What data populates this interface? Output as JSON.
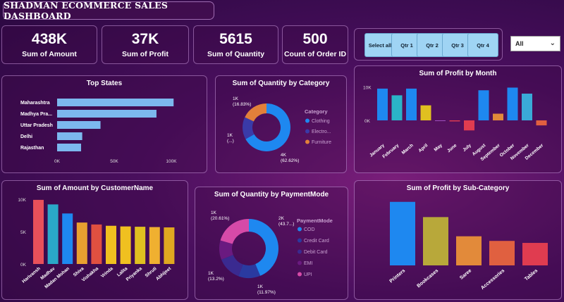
{
  "title": "SHADMAN ECOMMERCE SALES DASHBOARD",
  "kpis": [
    {
      "value": "438K",
      "label": "Sum of Amount"
    },
    {
      "value": "37K",
      "label": "Sum of Profit"
    },
    {
      "value": "5615",
      "label": "Sum of Quantity"
    },
    {
      "value": "500",
      "label": "Count of Order ID"
    }
  ],
  "quarters": [
    "Select all",
    "Qtr 1",
    "Qtr 2",
    "Qtr 3",
    "Qtr 4"
  ],
  "month_filter": {
    "selected": "All"
  },
  "colors": {
    "blue_bar": "#7cb8ee",
    "series": [
      "#1e88f0",
      "#2ab4c8",
      "#3460c8",
      "#e28a3a",
      "#f0c020",
      "#e03c50",
      "#d64aa8",
      "#9a3aa0"
    ]
  },
  "chart_data": [
    {
      "type": "bar",
      "orientation": "horizontal",
      "title": "Top States",
      "categories": [
        "Maharashtra",
        "Madhya Pra...",
        "Uttar Pradesh",
        "Delhi",
        "Rajasthan"
      ],
      "values": [
        102000,
        87000,
        38000,
        22000,
        21000
      ],
      "xticks": [
        "0K",
        "50K",
        "100K"
      ],
      "xlim": [
        0,
        100000
      ]
    },
    {
      "type": "pie",
      "donut": true,
      "title": "Sum of Quantity by Category",
      "legend_title": "Category",
      "categories": [
        "Clothing",
        "Electro...",
        "Furniture"
      ],
      "values": [
        3516,
        795,
        945
      ],
      "data_labels": [
        "4K\n(62.62%)",
        "1K\n(...)",
        "1K\n(16.83%)"
      ],
      "colors": [
        "#1e88f0",
        "#3a3aa8",
        "#e2803a"
      ]
    },
    {
      "type": "bar",
      "title": "Sum of Profit by Month",
      "categories": [
        "January",
        "February",
        "March",
        "April",
        "May",
        "June",
        "July",
        "August",
        "September",
        "October",
        "November",
        "December"
      ],
      "values": [
        9500,
        7500,
        9500,
        4500,
        -200,
        -300,
        -3000,
        9000,
        2000,
        9800,
        8000,
        -1500
      ],
      "yticks": [
        "10K",
        "0K"
      ],
      "ylim": [
        -4000,
        12000
      ],
      "colors": [
        "#1e88f0",
        "#2ab4c8",
        "#1e88f0",
        "#e0c020",
        "#a050c0",
        "#e03c50",
        "#e03c50",
        "#1e88f0",
        "#e28a3a",
        "#1e88f0",
        "#3aaad8",
        "#e06040"
      ]
    },
    {
      "type": "bar",
      "title": "Sum of Amount by CustomerName",
      "categories": [
        "Harivansh",
        "Madhav",
        "Madan Mohan",
        "Shiva",
        "Vishakha",
        "Vrinda",
        "Lalita",
        "Priyanka",
        "Shruti",
        "Abhijeet"
      ],
      "values": [
        9900,
        9200,
        7800,
        6400,
        6100,
        5900,
        5800,
        5750,
        5700,
        5650
      ],
      "yticks": [
        "10K",
        "5K",
        "0K"
      ],
      "ylim": [
        0,
        10000
      ],
      "colors": [
        "#e8505a",
        "#2aa8c8",
        "#1e88f0",
        "#e8a030",
        "#e05040",
        "#f0c020",
        "#f0c020",
        "#e0c020",
        "#f0b030",
        "#e0a820"
      ]
    },
    {
      "type": "pie",
      "donut": true,
      "title": "Sum of Quantity by PaymentMode",
      "legend_title": "PaymentMode",
      "categories": [
        "COD",
        "Credit Card",
        "Debit Card",
        "EMI",
        "UPI"
      ],
      "values": [
        2456,
        672,
        741,
        589,
        1157
      ],
      "data_labels": [
        "2K\n(43.7...)",
        "1K\n(11.97%)",
        "1K\n(13.2%)",
        "",
        "1K\n(20.61%)"
      ],
      "colors": [
        "#1e88f0",
        "#2a3aa0",
        "#3a2a90",
        "#6a1a80",
        "#d64aa8"
      ]
    },
    {
      "type": "bar",
      "title": "Sum of Profit by Sub-Category",
      "categories": [
        "Printers",
        "Bookcases",
        "Saree",
        "Accessories",
        "Tables"
      ],
      "values": [
        9600,
        7300,
        4400,
        3700,
        3400
      ],
      "ylim": [
        0,
        10000
      ],
      "colors": [
        "#1e88f0",
        "#b8a83a",
        "#e28a3a",
        "#e06040",
        "#e03c50"
      ]
    }
  ]
}
